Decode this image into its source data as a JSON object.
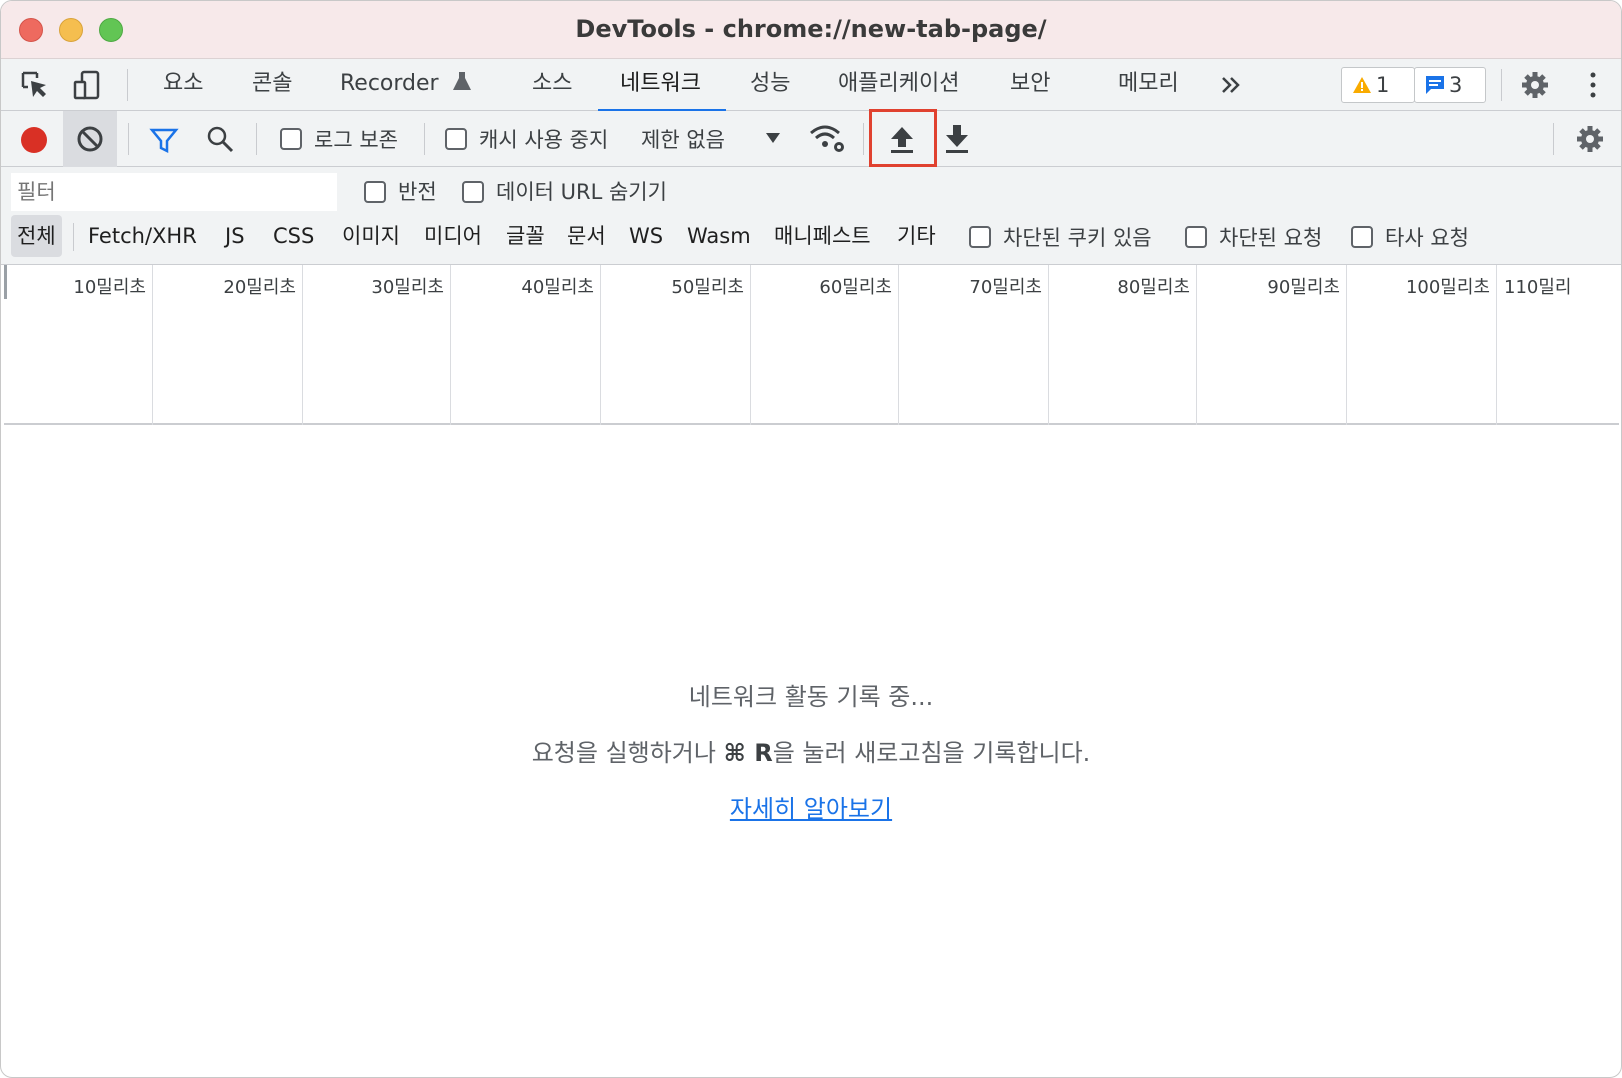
{
  "window": {
    "title": "DevTools - chrome://new-tab-page/"
  },
  "tabs": [
    {
      "label": "요소"
    },
    {
      "label": "콘솔"
    },
    {
      "label": "Recorder"
    },
    {
      "label": "소스"
    },
    {
      "label": "네트워크"
    },
    {
      "label": "성능"
    },
    {
      "label": "애플리케이션"
    },
    {
      "label": "보안"
    },
    {
      "label": "메모리"
    }
  ],
  "active_tab": "네트워크",
  "badges": {
    "warnings": "1",
    "messages": "3"
  },
  "toolbar": {
    "preserve_log": "로그 보존",
    "disable_cache": "캐시 사용 중지",
    "throttling": "제한 없음"
  },
  "filter": {
    "placeholder": "필터",
    "invert": "반전",
    "hide_data_urls": "데이터 URL 숨기기",
    "types": [
      "전체",
      "Fetch/XHR",
      "JS",
      "CSS",
      "이미지",
      "미디어",
      "글꼴",
      "문서",
      "WS",
      "Wasm",
      "매니페스트",
      "기타"
    ],
    "blocked_cookies": "차단된 쿠키 있음",
    "blocked_requests": "차단된 요청",
    "third_party": "타사 요청"
  },
  "timeline": {
    "ticks": [
      "10밀리초",
      "20밀리초",
      "30밀리초",
      "40밀리초",
      "50밀리초",
      "60밀리초",
      "70밀리초",
      "80밀리초",
      "90밀리초",
      "100밀리초",
      "110밀리"
    ]
  },
  "empty_state": {
    "line1": "네트워크 활동 기록 중...",
    "line2_prefix": "요청을 실행하거나 ",
    "line2_shortcut": "⌘ R",
    "line2_suffix": "을 눌러 새로고침을 기록합니다.",
    "link": "자세히 알아보기"
  },
  "colors": {
    "accent": "#1a73e8",
    "record": "#d93025",
    "highlight": "#e0412f"
  }
}
